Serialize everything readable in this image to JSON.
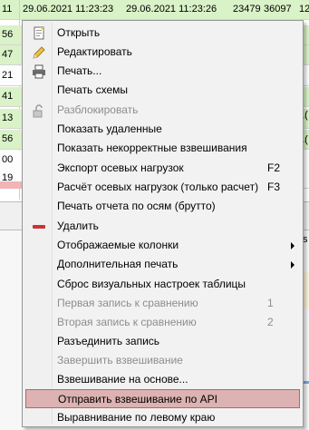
{
  "table": {
    "header": {
      "num": "11",
      "date1": "29.06.2021 11:23:23",
      "date2": "29.06.2021 11:23:26",
      "val1": "23479",
      "val2": "36097",
      "val3": "12"
    },
    "left_column": [
      "56",
      "47",
      "21",
      "41",
      "13",
      "56",
      "00",
      "19"
    ],
    "right_fragments": {
      "s": "s",
      "a": "1(",
      "b": "1("
    }
  },
  "context_menu": {
    "items": [
      {
        "label": "Открыть",
        "icon": "open-document-icon"
      },
      {
        "label": "Редактировать",
        "icon": "pencil-icon"
      },
      {
        "label": "Печать...",
        "icon": "printer-icon"
      },
      {
        "label": "Печать схемы"
      },
      {
        "label": "Разблокировать",
        "icon": "unlock-icon",
        "disabled": true
      },
      {
        "label": "Показать удаленные"
      },
      {
        "label": "Показать некорректные взвешивания"
      },
      {
        "label": "Экспорт осевых нагрузок",
        "shortcut": "F2"
      },
      {
        "label": "Расчёт осевых нагрузок (только расчет)",
        "shortcut": "F3"
      },
      {
        "label": "Печать отчета по осям (брутто)"
      },
      {
        "label": "Удалить",
        "icon": "delete-icon"
      },
      {
        "label": "Отображаемые колонки",
        "submenu": true
      },
      {
        "label": "Дополнительная печать",
        "submenu": true
      },
      {
        "label": "Сброс визуальных настроек таблицы"
      },
      {
        "label": "Первая запись к сравнению",
        "shortcut": "1",
        "disabled": true
      },
      {
        "label": "Вторая запись к сравнению",
        "shortcut": "2",
        "disabled": true
      },
      {
        "label": "Разъединить запись"
      },
      {
        "label": "Завершить взвешивание",
        "disabled": true
      },
      {
        "label": "Взвешивание на основе..."
      },
      {
        "label": "Отправить взвешивание по API",
        "highlighted": true
      },
      {
        "label": "Выравнивание по левому краю"
      }
    ]
  },
  "colors": {
    "row_green": "#d9f2c7",
    "highlight_bg": "#ddb2b2",
    "highlight_border": "#b56565",
    "delete_icon": "#cc3333"
  }
}
